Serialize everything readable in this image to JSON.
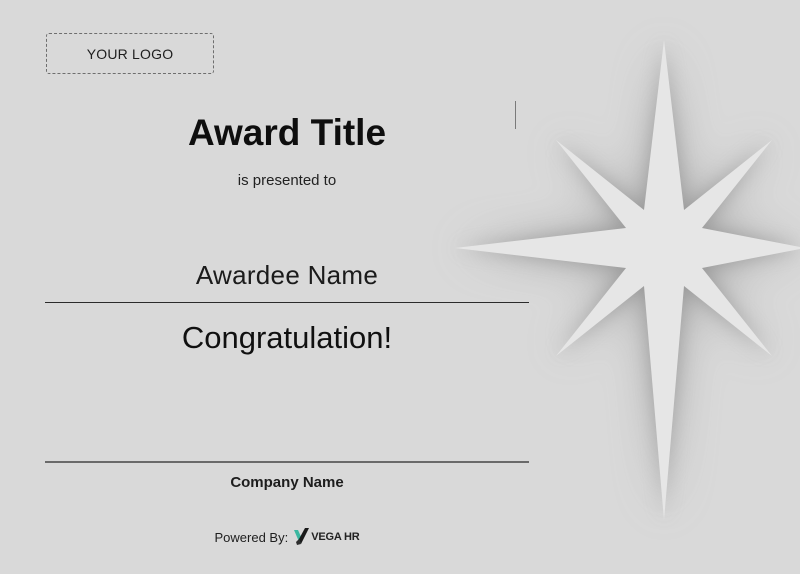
{
  "certificate": {
    "logo_placeholder": "YOUR LOGO",
    "award_title": "Award Title",
    "presented_text": "is presented to",
    "awardee_name": "Awardee Name",
    "congratulation": "Congratulation!",
    "company_name": "Company Name"
  },
  "footer": {
    "powered_label": "Powered By:",
    "brand_text": "VEGA HR"
  },
  "icons": {
    "decoration": "eight-point-star-icon",
    "brand": "vega-hr-logo-icon"
  },
  "colors": {
    "background": "#d9d9d9",
    "star_fill": "#e6e6e6",
    "star_shadow": "#7d7d7d",
    "text": "#0e0e0e",
    "brand_accent": "#3bb7a0"
  }
}
